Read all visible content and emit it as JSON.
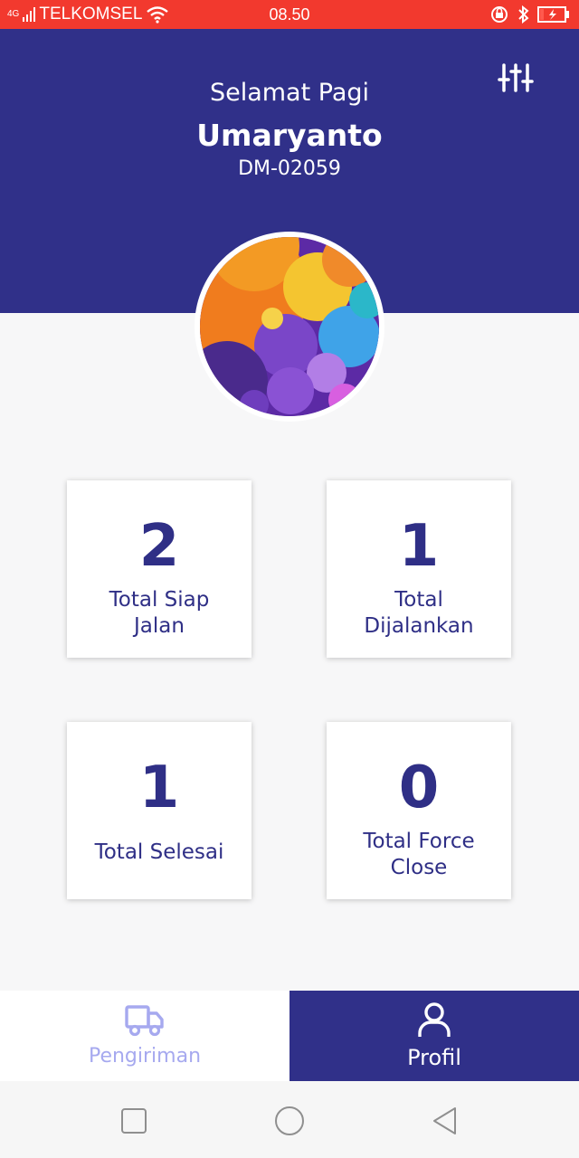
{
  "status_bar": {
    "network": "4G",
    "carrier": "TELKOMSEL",
    "time": "08.50"
  },
  "header": {
    "greeting": "Selamat Pagi",
    "name": "Umaryanto",
    "driver_id": "DM-02059"
  },
  "stats": [
    {
      "value": "2",
      "label_line1": "Total Siap",
      "label_line2": "Jalan"
    },
    {
      "value": "1",
      "label_line1": "Total",
      "label_line2": "Dijalankan"
    },
    {
      "value": "1",
      "label_line1": "Total Selesai"
    },
    {
      "value": "0",
      "label_line1": "Total Force",
      "label_line2": "Close"
    }
  ],
  "bottom_nav": [
    {
      "label": "Pengiriman",
      "icon": "truck-icon",
      "active": false
    },
    {
      "label": "Profil",
      "icon": "user-icon",
      "active": true
    }
  ],
  "colors": {
    "primary": "#303089",
    "status_bar": "#f2392e",
    "inactive_nav": "#a6a9ef",
    "background": "#f7f7f8"
  }
}
